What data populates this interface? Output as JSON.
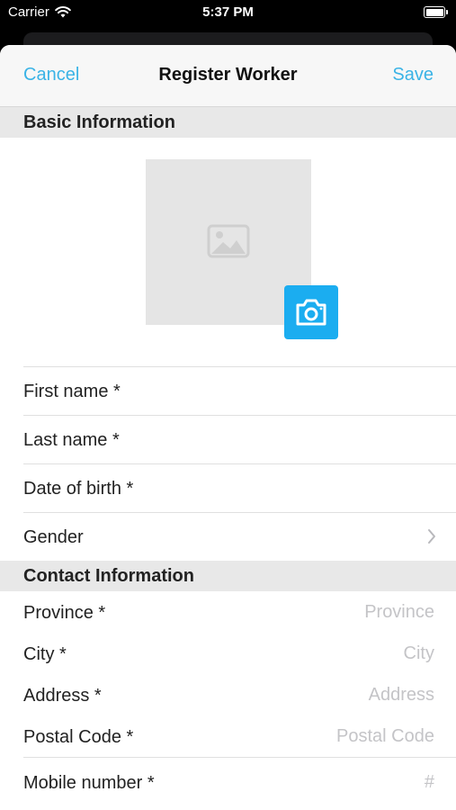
{
  "status_bar": {
    "carrier": "Carrier",
    "time": "5:37 PM"
  },
  "nav": {
    "cancel": "Cancel",
    "title": "Register Worker",
    "save": "Save"
  },
  "basic": {
    "header": "Basic Information",
    "rows": [
      "First name *",
      "Last name *",
      "Date of birth *",
      "Gender"
    ]
  },
  "contact": {
    "header": "Contact Information",
    "rows": [
      {
        "label": "Province *",
        "placeholder": "Province"
      },
      {
        "label": "City *",
        "placeholder": "City"
      },
      {
        "label": "Address *",
        "placeholder": "Address"
      },
      {
        "label": "Postal Code *",
        "placeholder": "Postal Code"
      },
      {
        "label": "Mobile number *",
        "placeholder": "#"
      }
    ]
  },
  "colors": {
    "accent": "#3ab3e6",
    "camera": "#1badf0",
    "section_bg": "#e8e8e8"
  },
  "icons": {
    "wifi": "wifi-icon",
    "battery": "battery-icon",
    "photo": "image-placeholder-icon",
    "camera": "camera-icon",
    "chevron": "chevron-right-icon"
  }
}
